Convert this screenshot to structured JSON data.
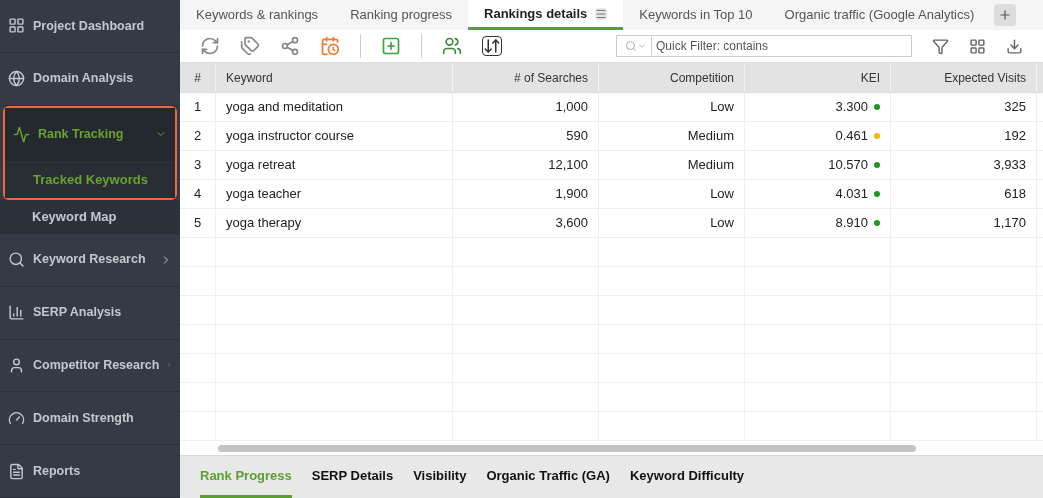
{
  "sidebar": {
    "items": [
      {
        "label": "Project Dashboard",
        "selected": false
      },
      {
        "label": "Domain Analysis",
        "selected": false
      },
      {
        "label": "Rank Tracking",
        "selected": true,
        "expanded": true,
        "children": [
          {
            "label": "Tracked Keywords",
            "selected": true
          },
          {
            "label": "Keyword Map",
            "selected": false
          }
        ]
      },
      {
        "label": "Keyword Research",
        "selected": false,
        "expanded": false
      },
      {
        "label": "SERP Analysis",
        "selected": false
      },
      {
        "label": "Competitor Research",
        "selected": false,
        "expanded": false
      },
      {
        "label": "Domain Strength",
        "selected": false
      },
      {
        "label": "Reports",
        "selected": false
      }
    ]
  },
  "tabs": [
    {
      "label": "Keywords & rankings",
      "selected": false
    },
    {
      "label": "Ranking progress",
      "selected": false
    },
    {
      "label": "Rankings details",
      "selected": true
    },
    {
      "label": "Keywords in Top 10",
      "selected": false
    },
    {
      "label": "Organic traffic (Google Analytics)",
      "selected": false
    }
  ],
  "quick_filter": {
    "placeholder": "Quick Filter: contains"
  },
  "table": {
    "columns": [
      "#",
      "Keyword",
      "# of Searches",
      "Competition",
      "KEI",
      "Expected Visits"
    ],
    "rows": [
      {
        "num": "1",
        "keyword": "yoga and meditation",
        "searches": "1,000",
        "competition": "Low",
        "kei": "3.300",
        "color": "#1a9a1a",
        "visits": "325"
      },
      {
        "num": "2",
        "keyword": "yoga instructor course",
        "searches": "590",
        "competition": "Medium",
        "kei": "0.461",
        "color": "#f5b50f",
        "visits": "192"
      },
      {
        "num": "3",
        "keyword": "yoga retreat",
        "searches": "12,100",
        "competition": "Medium",
        "kei": "10.570",
        "color": "#1a9a1a",
        "visits": "3,933"
      },
      {
        "num": "4",
        "keyword": "yoga teacher",
        "searches": "1,900",
        "competition": "Low",
        "kei": "4.031",
        "color": "#1a9a1a",
        "visits": "618"
      },
      {
        "num": "5",
        "keyword": "yoga therapy",
        "searches": "3,600",
        "competition": "Low",
        "kei": "8.910",
        "color": "#1a9a1a",
        "visits": "1,170"
      }
    ]
  },
  "bottom_tabs": [
    {
      "label": "Rank Progress",
      "selected": true
    },
    {
      "label": "SERP Details",
      "selected": false
    },
    {
      "label": "Visibility",
      "selected": false
    },
    {
      "label": "Organic Traffic (GA)",
      "selected": false
    },
    {
      "label": "Keyword Difficulty",
      "selected": false
    }
  ]
}
